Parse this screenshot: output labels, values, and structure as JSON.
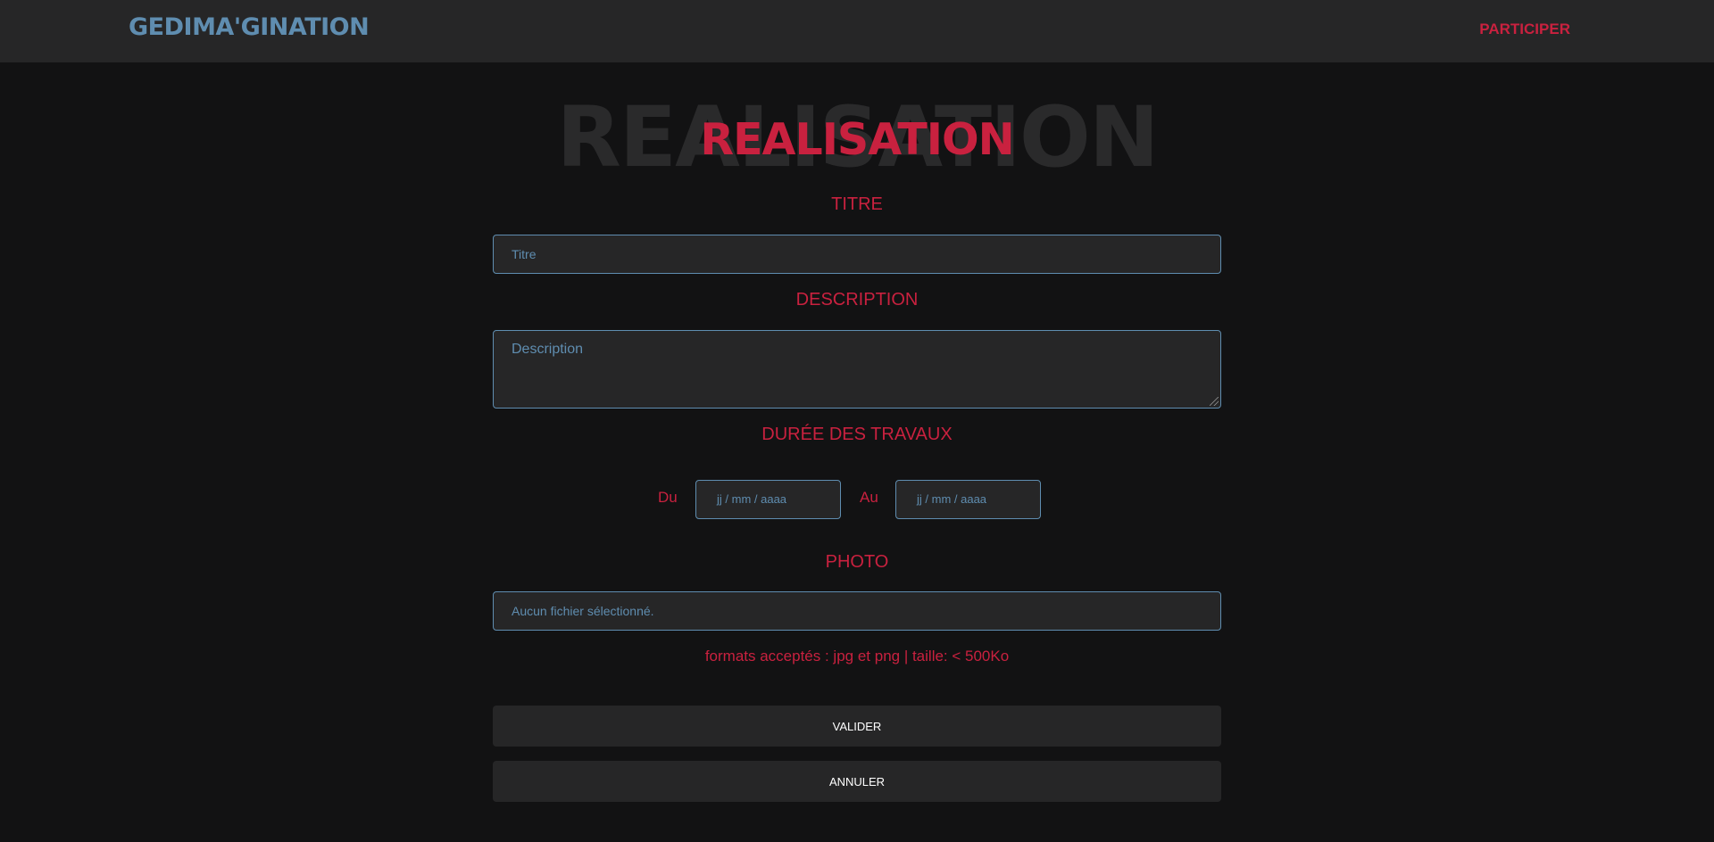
{
  "header": {
    "brand": "GEDIMA'GINATION",
    "nav_link": "PARTICIPER"
  },
  "page": {
    "title_background": "REALISATION",
    "title": "REALISATION"
  },
  "form": {
    "title_label": "TITRE",
    "title_placeholder": "Titre",
    "description_label": "DESCRIPTION",
    "description_placeholder": "Description",
    "duration_label": "DURÉE DES TRAVAUX",
    "from_label": "Du",
    "from_placeholder": "jj / mm / aaaa",
    "to_label": "Au",
    "to_placeholder": "jj / mm / aaaa",
    "photo_label": "PHOTO",
    "photo_status": "Aucun fichier sélectionné.",
    "photo_hint": "formats acceptés : jpg et png | taille: < 500Ko"
  },
  "actions": {
    "submit": "VALIDER",
    "cancel": "ANNULER"
  },
  "colors": {
    "background": "#121213",
    "surface": "#262627",
    "accent_red": "#c9213f",
    "accent_blue": "#5f8db0"
  }
}
